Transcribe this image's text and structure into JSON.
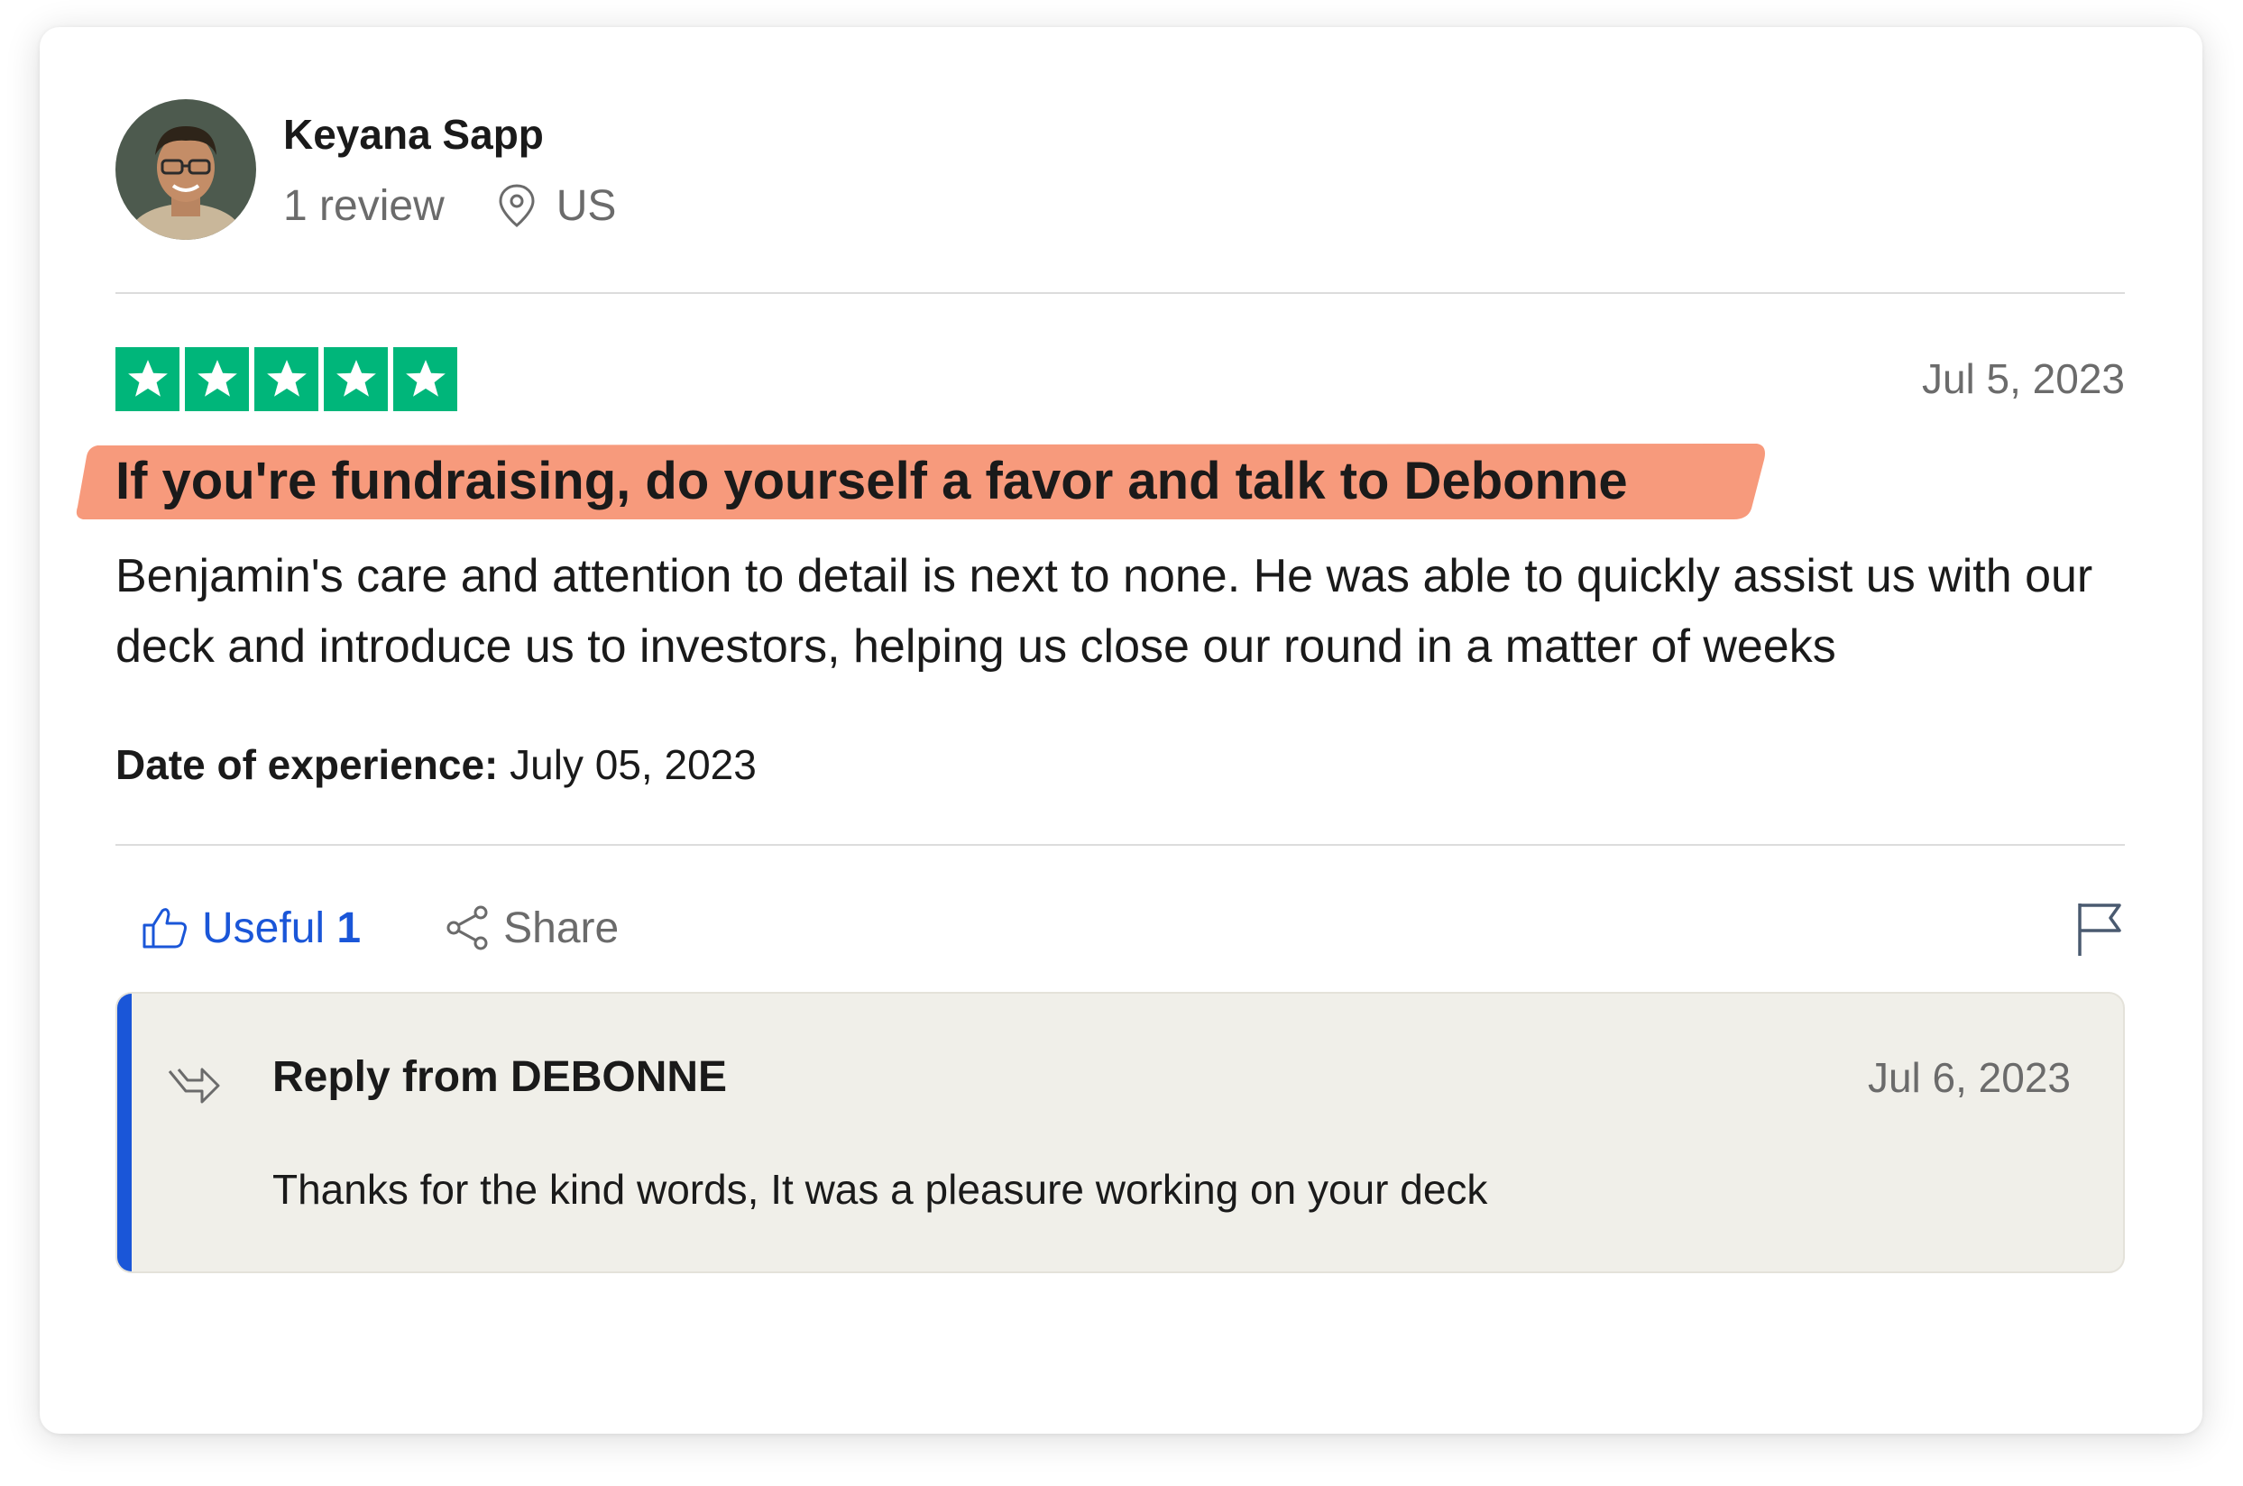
{
  "reviewer": {
    "name": "Keyana Sapp",
    "review_count": "1 review",
    "location": "US"
  },
  "review": {
    "rating": 5,
    "date": "Jul 5, 2023",
    "headline": "If you're fundraising, do yourself a favor and talk to Debonne",
    "body": "Benjamin's care and attention to detail is next to none. He was able to quickly assist us with our deck and introduce us to investors, helping us close our round in a matter of weeks",
    "experience_label": "Date of experience:",
    "experience_date": "July 05, 2023"
  },
  "actions": {
    "useful_label": "Useful",
    "useful_count": "1",
    "share_label": "Share"
  },
  "reply": {
    "title": "Reply from DEBONNE",
    "date": "Jul 6, 2023",
    "text": "Thanks for the kind words, It was a pleasure working on your deck"
  },
  "colors": {
    "star_green": "#00b67a",
    "highlight": "#f79a7c",
    "link_blue": "#1a56d8",
    "reply_bg": "#f0efe9"
  },
  "icons": [
    "location-pin-icon",
    "star-icon",
    "thumbs-up-icon",
    "share-icon",
    "flag-icon",
    "reply-arrow-icon"
  ]
}
